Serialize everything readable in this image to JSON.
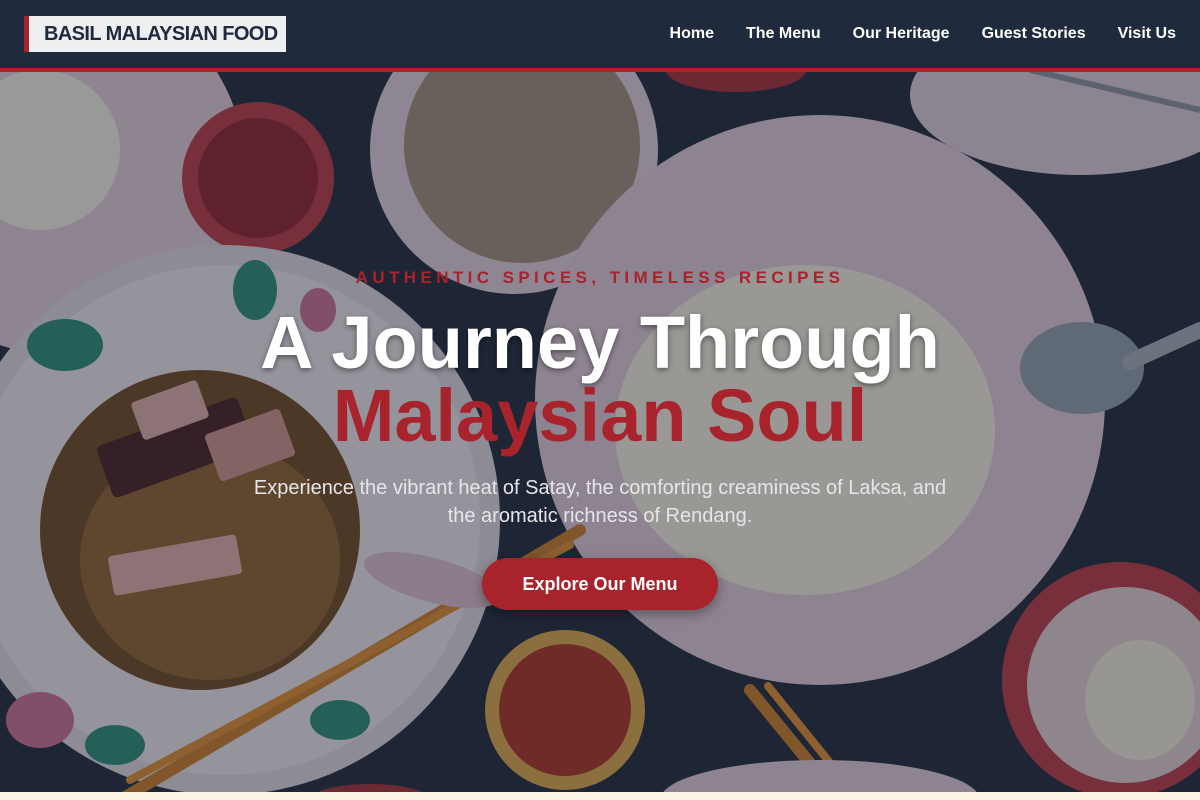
{
  "brand": {
    "name": "BASIL MALAYSIAN FOOD"
  },
  "nav": {
    "items": [
      {
        "label": "Home"
      },
      {
        "label": "The Menu"
      },
      {
        "label": "Our Heritage"
      },
      {
        "label": "Guest Stories"
      },
      {
        "label": "Visit Us"
      }
    ]
  },
  "hero": {
    "eyebrow": "AUTHENTIC SPICES, TIMELESS RECIPES",
    "title_line1": "A Journey Through",
    "title_line2": "Malaysian Soul",
    "subtitle": "Experience the vibrant heat of Satay, the comforting creaminess of Laksa, and the aromatic richness of Rendang.",
    "cta_label": "Explore Our Menu"
  },
  "colors": {
    "accent": "#a8232c",
    "header_bg": "#1f2a3d",
    "logo_bg": "#eeeff1"
  }
}
